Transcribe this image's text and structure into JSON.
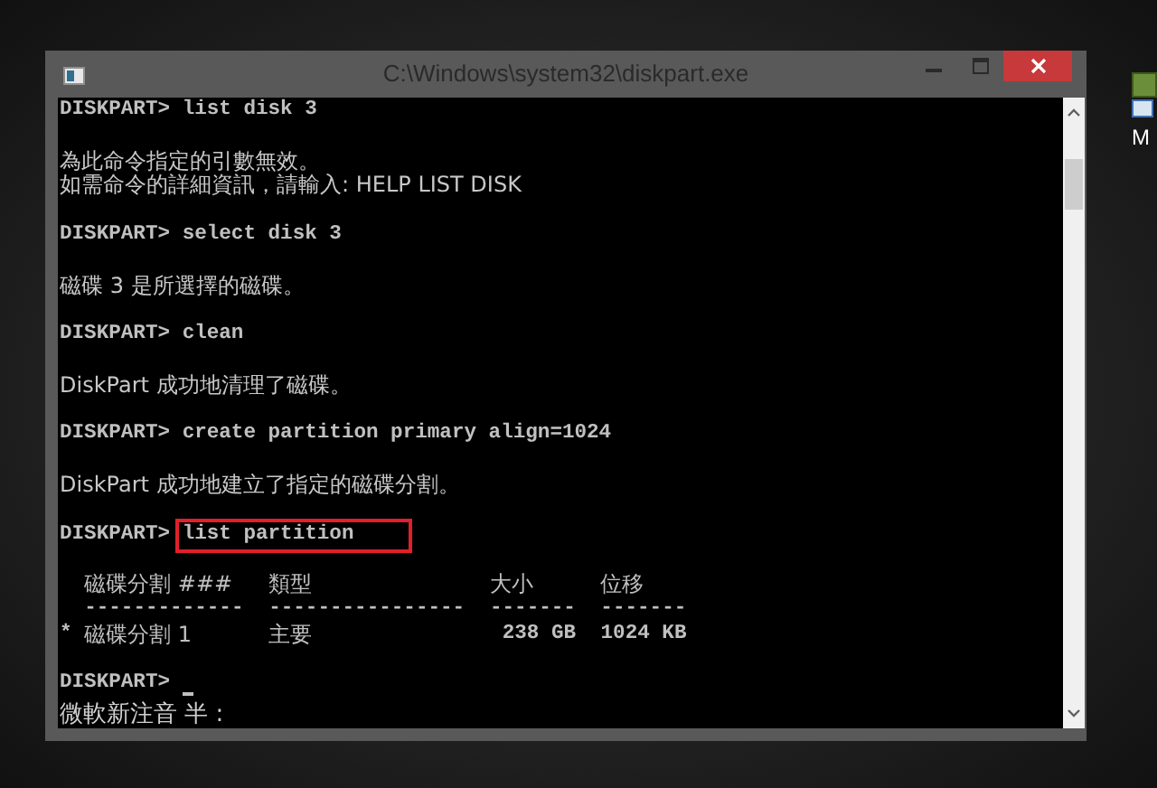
{
  "window": {
    "title": "C:\\Windows\\system32\\diskpart.exe"
  },
  "desktop_icons": [
    {
      "label": "M"
    }
  ],
  "console": {
    "lines": [
      {
        "kind": "command",
        "prompt": "DISKPART>",
        "command": "list disk 3"
      },
      {
        "kind": "blank"
      },
      {
        "kind": "output",
        "text": "為此命令指定的引數無效。"
      },
      {
        "kind": "output",
        "text": "如需命令的詳細資訊，請輸入: HELP LIST DISK"
      },
      {
        "kind": "blank"
      },
      {
        "kind": "command",
        "prompt": "DISKPART>",
        "command": "select disk 3"
      },
      {
        "kind": "blank"
      },
      {
        "kind": "output",
        "text": "磁碟 3 是所選擇的磁碟。"
      },
      {
        "kind": "blank"
      },
      {
        "kind": "command",
        "prompt": "DISKPART>",
        "command": "clean"
      },
      {
        "kind": "blank"
      },
      {
        "kind": "output",
        "text": "DiskPart 成功地清理了磁碟。"
      },
      {
        "kind": "blank"
      },
      {
        "kind": "command",
        "prompt": "DISKPART>",
        "command": "create partition primary align=1024"
      },
      {
        "kind": "blank"
      },
      {
        "kind": "output",
        "text": "DiskPart 成功地建立了指定的磁碟分割。"
      },
      {
        "kind": "blank"
      },
      {
        "kind": "command",
        "prompt": "DISKPART>",
        "command": "list partition",
        "highlighted": true
      },
      {
        "kind": "blank"
      },
      {
        "kind": "table",
        "columns": [
          "磁碟分割 ###",
          "類型",
          "大小",
          "位移"
        ],
        "rules": [
          "-------------",
          "----------------",
          "-------",
          "-------"
        ],
        "rows": [
          {
            "marker": "*",
            "cells": [
              "磁碟分割 1",
              "主要",
              "238 GB",
              "1024 KB"
            ]
          }
        ]
      },
      {
        "kind": "blank"
      },
      {
        "kind": "command",
        "prompt": "DISKPART>",
        "cursor": true
      }
    ],
    "ime_status": "微軟新注音 半 :"
  }
}
